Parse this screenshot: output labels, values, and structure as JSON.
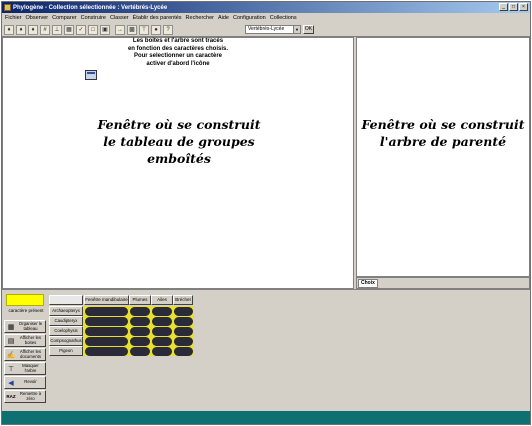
{
  "window": {
    "title": "Phylogène - Collection sélectionnée : Vertébrés-Lycée",
    "controls": [
      "_",
      "□",
      "×"
    ]
  },
  "menu": [
    "Fichier",
    "Observer",
    "Comparer",
    "Construire",
    "Classer",
    "Établir des parentés",
    "Rechercher",
    "Aide",
    "Configuration",
    "Collections"
  ],
  "toolbar": {
    "collection_select": "Vertébrés-Lycée",
    "ok_label": "OK",
    "icons": [
      "tool-icon-1",
      "tool-icon-2",
      "tool-icon-3",
      "grid-icon",
      "tree-icon",
      "table-icon",
      "check-icon",
      "folder-icon",
      "folder-open-icon",
      "arrow-icon",
      "select-icon",
      "tree-view-icon",
      "key-icon",
      "help-icon"
    ]
  },
  "left_pane": {
    "info_lines": [
      "Les boites et l'arbre sont tracés",
      "en fonction des caractères choisis.",
      "Pour selectionner un caractère",
      "activer d'abord l'icône"
    ],
    "caption_lines": [
      "Fenêtre où se construit",
      "le tableau de groupes",
      "emboîtés"
    ]
  },
  "right_pane": {
    "caption_lines": [
      "Fenêtre où se construit",
      "l'arbre de parenté"
    ],
    "tab_label": "Choix"
  },
  "bottom_panel": {
    "swatch_color": "#ffff00",
    "caract_label": "caractère présent",
    "side_buttons": [
      {
        "label": "Organiser le tableau",
        "icon": "grid-icon"
      },
      {
        "label": "Afficher les boites",
        "icon": "boxes-icon"
      },
      {
        "label": "Afficher les documents",
        "icon": "document-icon"
      },
      {
        "label": "Masquer l'arbre",
        "icon": "tree-icon"
      },
      {
        "label": "Revoir",
        "icon": "back-arrow-icon"
      },
      {
        "label": "Remettre à zéro",
        "icon": "raz-icon",
        "icon_text": "RAZ"
      }
    ],
    "matrix": {
      "columns": [
        "Fenêtre mandibulaire",
        "Plumes",
        "Ailes",
        "Bréchet"
      ],
      "rows": [
        "Archaeopteryx",
        "Caudipteryx",
        "Coelophysis",
        "Compsognathus",
        "Pigeon"
      ]
    }
  }
}
